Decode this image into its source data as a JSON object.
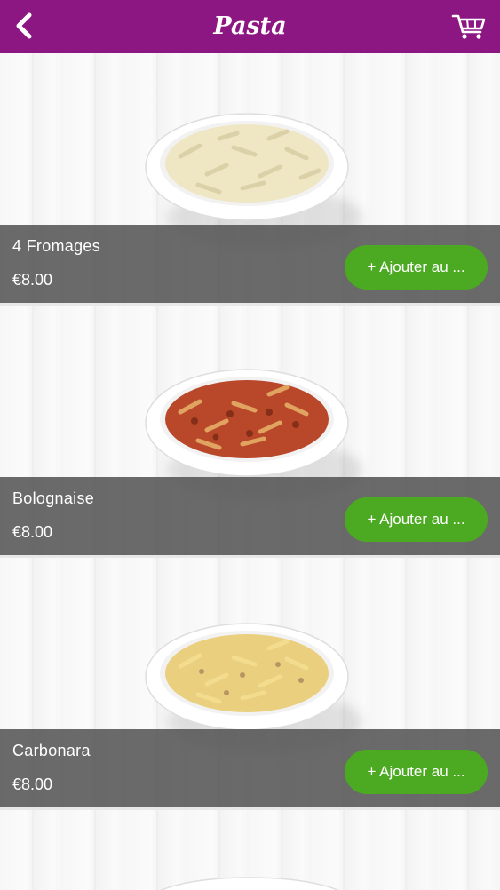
{
  "header": {
    "title": "Pasta",
    "back_icon": "chevron-left-icon",
    "cart_icon": "cart-icon",
    "color": "#8c1782"
  },
  "products": [
    {
      "name": "4 Fromages",
      "price": "€8.00",
      "add_label": "+ Ajouter au ...",
      "sauce_color": "#efe6c4"
    },
    {
      "name": "Bolognaise",
      "price": "€8.00",
      "add_label": "+ Ajouter au ...",
      "sauce_color": "#b9472a"
    },
    {
      "name": "Carbonara",
      "price": "€8.00",
      "add_label": "+ Ajouter au ...",
      "sauce_color": "#e9cf7e"
    }
  ],
  "button_color": "#4caa22"
}
